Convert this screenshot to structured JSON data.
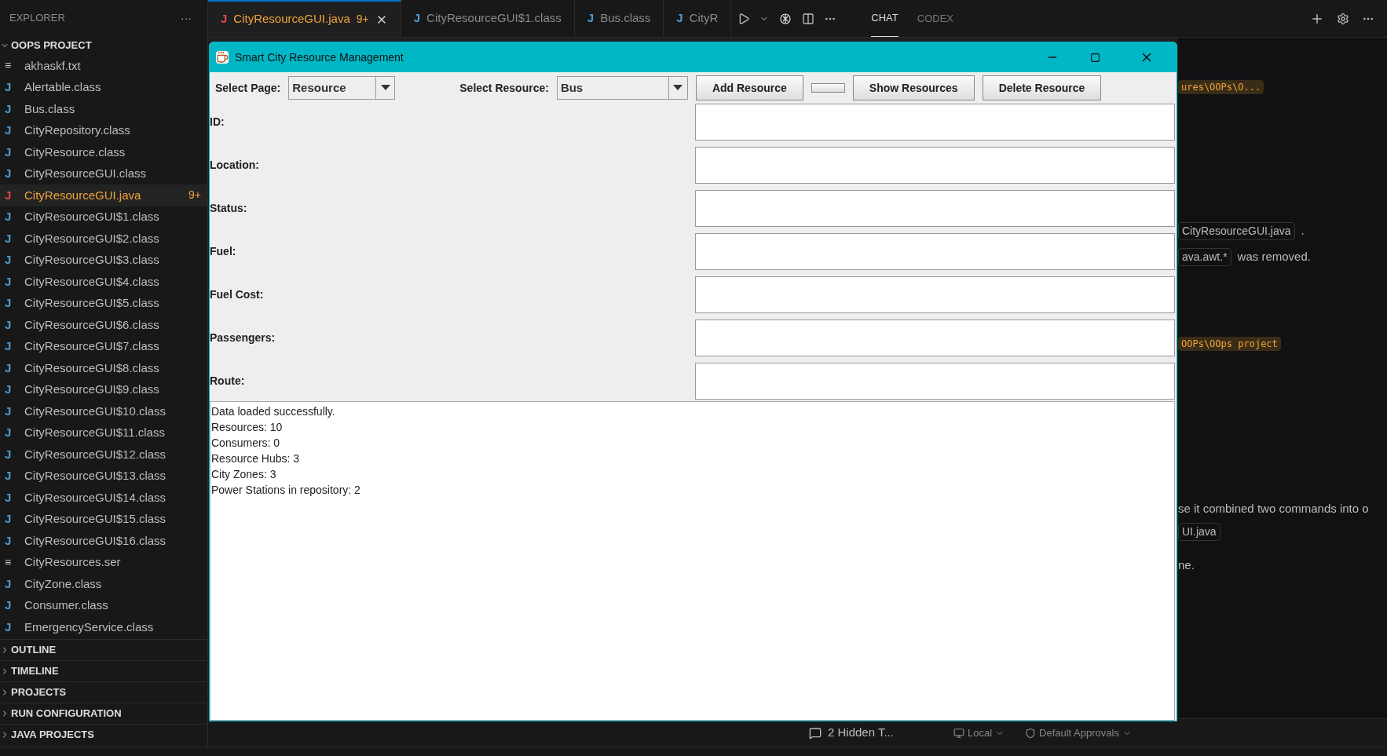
{
  "explorer": {
    "title": "EXPLORER",
    "more": "···",
    "project": "OOPS PROJECT",
    "files": [
      {
        "icon": "≡",
        "name": "akhaskf.txt",
        "kind": "text",
        "selected": false
      },
      {
        "icon": "J",
        "name": "Alertable.class",
        "kind": "java",
        "selected": false
      },
      {
        "icon": "J",
        "name": "Bus.class",
        "kind": "java",
        "selected": false
      },
      {
        "icon": "J",
        "name": "CityRepository.class",
        "kind": "java",
        "selected": false
      },
      {
        "icon": "J",
        "name": "CityResource.class",
        "kind": "java",
        "selected": false
      },
      {
        "icon": "J",
        "name": "CityResourceGUI.class",
        "kind": "java",
        "selected": false
      },
      {
        "icon": "J",
        "name": "CityResourceGUI.java",
        "kind": "java",
        "selected": true,
        "badge": "9+"
      },
      {
        "icon": "J",
        "name": "CityResourceGUI$1.class",
        "kind": "java",
        "selected": false
      },
      {
        "icon": "J",
        "name": "CityResourceGUI$2.class",
        "kind": "java",
        "selected": false
      },
      {
        "icon": "J",
        "name": "CityResourceGUI$3.class",
        "kind": "java",
        "selected": false
      },
      {
        "icon": "J",
        "name": "CityResourceGUI$4.class",
        "kind": "java",
        "selected": false
      },
      {
        "icon": "J",
        "name": "CityResourceGUI$5.class",
        "kind": "java",
        "selected": false
      },
      {
        "icon": "J",
        "name": "CityResourceGUI$6.class",
        "kind": "java",
        "selected": false
      },
      {
        "icon": "J",
        "name": "CityResourceGUI$7.class",
        "kind": "java",
        "selected": false
      },
      {
        "icon": "J",
        "name": "CityResourceGUI$8.class",
        "kind": "java",
        "selected": false
      },
      {
        "icon": "J",
        "name": "CityResourceGUI$9.class",
        "kind": "java",
        "selected": false
      },
      {
        "icon": "J",
        "name": "CityResourceGUI$10.class",
        "kind": "java",
        "selected": false
      },
      {
        "icon": "J",
        "name": "CityResourceGUI$11.class",
        "kind": "java",
        "selected": false
      },
      {
        "icon": "J",
        "name": "CityResourceGUI$12.class",
        "kind": "java",
        "selected": false
      },
      {
        "icon": "J",
        "name": "CityResourceGUI$13.class",
        "kind": "java",
        "selected": false
      },
      {
        "icon": "J",
        "name": "CityResourceGUI$14.class",
        "kind": "java",
        "selected": false
      },
      {
        "icon": "J",
        "name": "CityResourceGUI$15.class",
        "kind": "java",
        "selected": false
      },
      {
        "icon": "J",
        "name": "CityResourceGUI$16.class",
        "kind": "java",
        "selected": false
      },
      {
        "icon": "≡",
        "name": "CityResources.ser",
        "kind": "text",
        "selected": false
      },
      {
        "icon": "J",
        "name": "CityZone.class",
        "kind": "java",
        "selected": false
      },
      {
        "icon": "J",
        "name": "Consumer.class",
        "kind": "java",
        "selected": false
      },
      {
        "icon": "J",
        "name": "EmergencyService.class",
        "kind": "java",
        "selected": false
      }
    ],
    "sections": [
      "OUTLINE",
      "TIMELINE",
      "PROJECTS",
      "RUN CONFIGURATION",
      "JAVA PROJECTS"
    ]
  },
  "editor_tabs": [
    {
      "icon": "J",
      "label": "CityResourceGUI.java",
      "selected": true,
      "badge": "9+"
    },
    {
      "icon": "J",
      "label": "CityResourceGUI$1.class",
      "selected": false
    },
    {
      "icon": "J",
      "label": "Bus.class",
      "selected": false
    },
    {
      "icon": "J",
      "label": "CityR",
      "selected": false
    }
  ],
  "panel_tabs": [
    {
      "label": "CHAT",
      "selected": true
    },
    {
      "label": "CODEX",
      "selected": false
    }
  ],
  "chat": [
    {
      "kind": "path",
      "text": "ures\\OOPs\\O..."
    },
    {
      "kind": "chip",
      "text": "CityResourceGUI.java",
      "after": "."
    },
    {
      "kind": "chip",
      "text": "ava.awt.*",
      "after": "was removed."
    },
    {
      "kind": "path",
      "text": "OOPs\\OOps project"
    },
    {
      "kind": "text",
      "text": "se it combined two commands into o"
    },
    {
      "kind": "chip",
      "text": "UI.java"
    },
    {
      "kind": "text",
      "text": "ne."
    }
  ],
  "bottom": {
    "hidden": "2 Hidden T...",
    "mode": "Local",
    "approvals": "Default Approvals"
  },
  "app_window": {
    "title": "Smart City Resource Management",
    "page_label": "Select Page:",
    "page_value": "Resource",
    "resource_label": "Select Resource:",
    "resource_value": "Bus",
    "buttons": [
      {
        "label": "Add Resource"
      },
      {
        "kind": "blank"
      },
      {
        "label": "Show Resources"
      },
      {
        "label": "Delete Resource"
      }
    ],
    "fields": [
      "ID:",
      "Location:",
      "Status:",
      "Fuel:",
      "Fuel Cost:",
      "Passengers:",
      "Route:"
    ],
    "output": [
      "Data loaded successfully.",
      "Resources: 10",
      "Consumers: 0",
      "Resource Hubs: 3",
      "City Zones: 3",
      "Power Stations in repository: 2"
    ]
  }
}
